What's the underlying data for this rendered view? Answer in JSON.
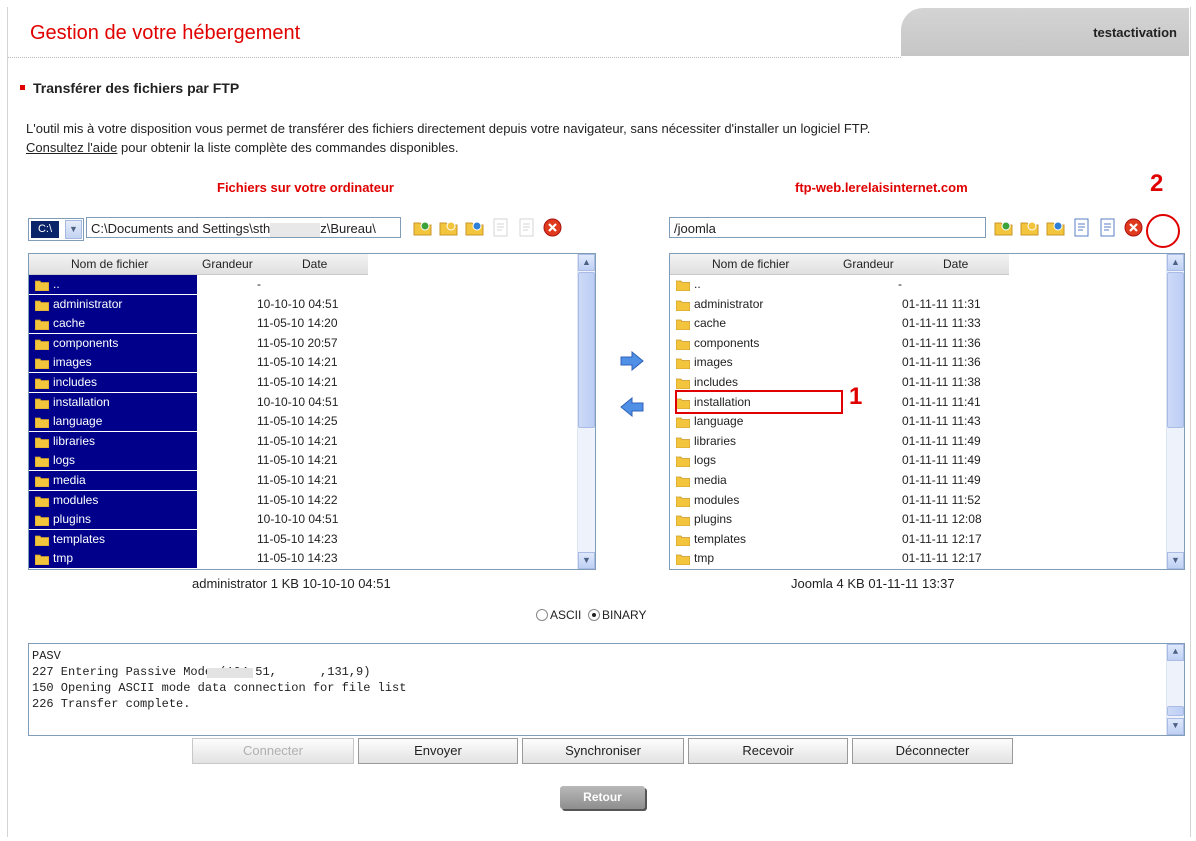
{
  "header": {
    "title": "Gestion de votre hébergement",
    "user": "testactivation"
  },
  "section": {
    "title": "Transférer des fichiers par FTP",
    "description": "L'outil mis à votre disposition vous permet de transférer des fichiers directement depuis votre navigateur, sans nécessiter d'installer un logiciel FTP.",
    "help_link": "Consultez l'aide",
    "help_suffix": " pour obtenir la liste complète des commandes disponibles."
  },
  "local": {
    "title": "Fichiers sur votre ordinateur",
    "drive": "C:\\",
    "path_left": "C:\\Documents and Settings\\sth",
    "path_right": "z\\Bureau\\",
    "columns": [
      "Nom de fichier",
      "Grandeur",
      "Date"
    ],
    "files": [
      {
        "name": "..",
        "size": "",
        "date": "-"
      },
      {
        "name": "administrator",
        "size": "",
        "date": "10-10-10 04:51"
      },
      {
        "name": "cache",
        "size": "",
        "date": "11-05-10 14:20"
      },
      {
        "name": "components",
        "size": "",
        "date": "11-05-10 20:57"
      },
      {
        "name": "images",
        "size": "",
        "date": "11-05-10 14:21"
      },
      {
        "name": "includes",
        "size": "",
        "date": "11-05-10 14:21"
      },
      {
        "name": "installation",
        "size": "",
        "date": "10-10-10 04:51"
      },
      {
        "name": "language",
        "size": "",
        "date": "11-05-10 14:25"
      },
      {
        "name": "libraries",
        "size": "",
        "date": "11-05-10 14:21"
      },
      {
        "name": "logs",
        "size": "",
        "date": "11-05-10 14:21"
      },
      {
        "name": "media",
        "size": "",
        "date": "11-05-10 14:21"
      },
      {
        "name": "modules",
        "size": "",
        "date": "11-05-10 14:22"
      },
      {
        "name": "plugins",
        "size": "",
        "date": "10-10-10 04:51"
      },
      {
        "name": "templates",
        "size": "",
        "date": "11-05-10 14:23"
      },
      {
        "name": "tmp",
        "size": "",
        "date": "11-05-10 14:23"
      }
    ],
    "status": "administrator  1 KB  10-10-10 04:51"
  },
  "remote": {
    "title": "ftp-web.lerelaisinternet.com",
    "path": "/joomla",
    "columns": [
      "Nom de fichier",
      "Grandeur",
      "Date"
    ],
    "files": [
      {
        "name": "..",
        "size": "",
        "date": "-"
      },
      {
        "name": "administrator",
        "size": "",
        "date": "01-11-11 11:31"
      },
      {
        "name": "cache",
        "size": "",
        "date": "01-11-11 11:33"
      },
      {
        "name": "components",
        "size": "",
        "date": "01-11-11 11:36"
      },
      {
        "name": "images",
        "size": "",
        "date": "01-11-11 11:36"
      },
      {
        "name": "includes",
        "size": "",
        "date": "01-11-11 11:38"
      },
      {
        "name": "installation",
        "size": "",
        "date": "01-11-11 11:41"
      },
      {
        "name": "language",
        "size": "",
        "date": "01-11-11 11:43"
      },
      {
        "name": "libraries",
        "size": "",
        "date": "01-11-11 11:49"
      },
      {
        "name": "logs",
        "size": "",
        "date": "01-11-11 11:49"
      },
      {
        "name": "media",
        "size": "",
        "date": "01-11-11 11:49"
      },
      {
        "name": "modules",
        "size": "",
        "date": "01-11-11 11:52"
      },
      {
        "name": "plugins",
        "size": "",
        "date": "01-11-11 12:08"
      },
      {
        "name": "templates",
        "size": "",
        "date": "01-11-11 12:17"
      },
      {
        "name": "tmp",
        "size": "",
        "date": "01-11-11 12:17"
      }
    ],
    "status": "Joomla  4 KB  01-11-11 13:37"
  },
  "annotations": {
    "mark1": "1",
    "mark2": "2"
  },
  "mode": {
    "ascii": "ASCII",
    "binary": "BINARY",
    "selected": "BINARY"
  },
  "log": [
    "PASV",
    "227 Entering Passive Mode (194,51,      ,131,9)",
    "150 Opening ASCII mode data connection for file list",
    "226 Transfer complete."
  ],
  "buttons": {
    "connect": "Connecter",
    "send": "Envoyer",
    "sync": "Synchroniser",
    "receive": "Recevoir",
    "disconnect": "Déconnecter",
    "back": "Retour"
  },
  "colors": {
    "accent": "#e00000",
    "selection": "#00008b",
    "folder": "#f3c53c"
  },
  "icons": {
    "toolbar": [
      "upload-folder-icon",
      "new-folder-icon",
      "refresh-folder-icon",
      "view-file-icon",
      "edit-file-icon",
      "delete-icon"
    ],
    "transfer": [
      "arrow-right-icon",
      "arrow-left-icon"
    ]
  }
}
